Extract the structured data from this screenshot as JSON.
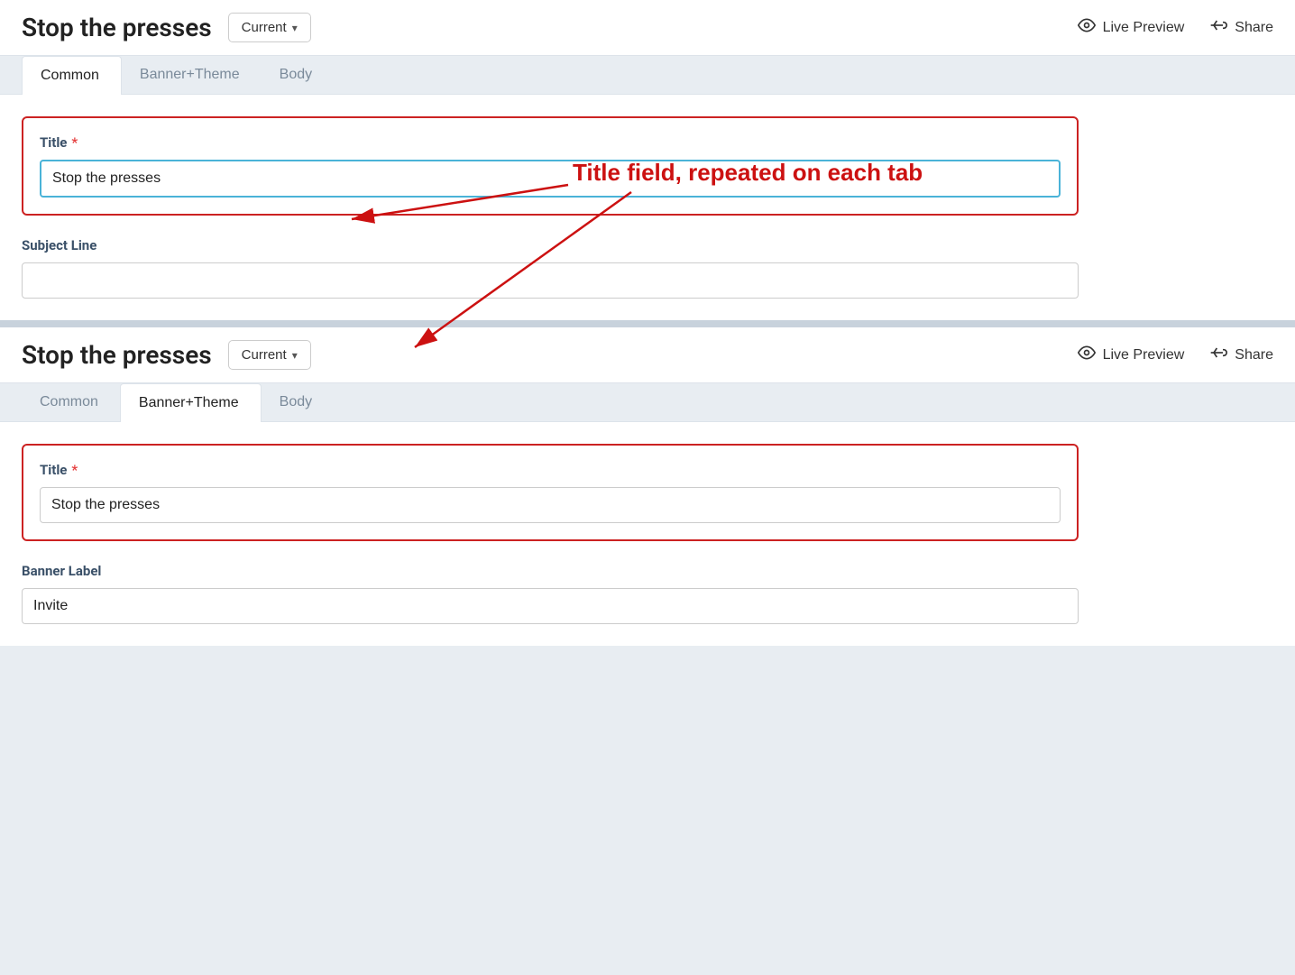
{
  "app": {
    "title": "Stop the presses"
  },
  "header": {
    "version_label": "Current",
    "version_chevron": "▾",
    "live_preview_label": "Live Preview",
    "share_label": "Share"
  },
  "tabs_top": {
    "items": [
      {
        "id": "common",
        "label": "Common",
        "active": true
      },
      {
        "id": "banner_theme",
        "label": "Banner+Theme",
        "active": false
      },
      {
        "id": "body",
        "label": "Body",
        "active": false
      }
    ]
  },
  "tabs_bottom": {
    "items": [
      {
        "id": "common",
        "label": "Common",
        "active": false
      },
      {
        "id": "banner_theme",
        "label": "Banner+Theme",
        "active": true
      },
      {
        "id": "body",
        "label": "Body",
        "active": false
      }
    ]
  },
  "form_top": {
    "title_label": "Title",
    "title_required": "*",
    "title_value": "Stop the presses",
    "subject_label": "Subject Line",
    "subject_value": ""
  },
  "form_bottom": {
    "title_label": "Title",
    "title_required": "*",
    "title_value": "Stop the presses",
    "banner_label": "Banner Label",
    "banner_value": "Invite"
  },
  "annotation": {
    "text": "Title field, repeated on each tab"
  }
}
